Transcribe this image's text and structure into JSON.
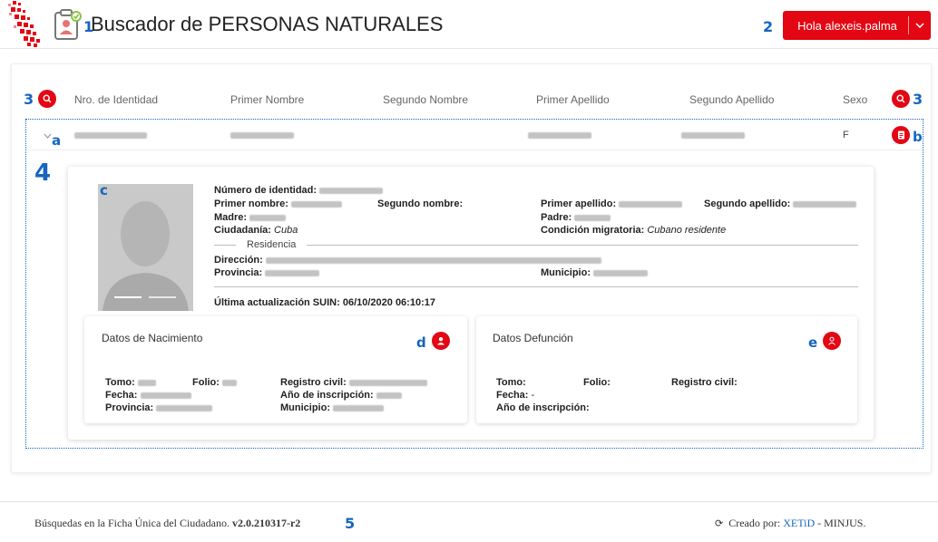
{
  "header": {
    "title": "Buscador de PERSONAS NATURALES",
    "user_button_label": "Hola alexeis.palma",
    "brand_color": "#e30613",
    "callout_color": "#1565c0"
  },
  "callouts": {
    "n1": "1",
    "n2": "2",
    "n3": "3",
    "n4": "4",
    "n5": "5",
    "a": "a",
    "b": "b",
    "c": "c",
    "d": "d",
    "e": "e"
  },
  "table": {
    "columns": [
      "Nro. de Identidad",
      "Primer Nombre",
      "Segundo Nombre",
      "Primer Apellido",
      "Segundo Apellido",
      "Sexo"
    ],
    "rows": [
      {
        "sexo": "F"
      }
    ]
  },
  "detail": {
    "numero_identidad_label": "Número de identidad:",
    "primer_nombre_label": "Primer nombre:",
    "segundo_nombre_label": "Segundo nombre:",
    "primer_apellido_label": "Primer apellido:",
    "segundo_apellido_label": "Segundo apellido:",
    "madre_label": "Madre:",
    "padre_label": "Padre:",
    "ciudadania_label": "Ciudadanía:",
    "ciudadania_value": "Cuba",
    "condicion_label": "Condición migratoria:",
    "condicion_value": "Cubano residente",
    "residencia_label": "Residencia",
    "direccion_label": "Dirección:",
    "provincia_label": "Provincia:",
    "municipio_label": "Municipio:",
    "ultima_label": "Última actualización SUIN:",
    "ultima_value": "06/10/2020 06:10:17"
  },
  "nacimiento": {
    "title": "Datos de Nacimiento",
    "tomo_label": "Tomo:",
    "folio_label": "Folio:",
    "registro_label": "Registro civil:",
    "fecha_label": "Fecha:",
    "anio_label": "Año de inscripción:",
    "provincia_label": "Provincia:",
    "municipio_label": "Municipio:"
  },
  "defuncion": {
    "title": "Datos Defunción",
    "tomo_label": "Tomo:",
    "folio_label": "Folio:",
    "registro_label": "Registro civil:",
    "fecha_label": "Fecha:",
    "fecha_value": "-",
    "anio_label": "Año de inscripción:"
  },
  "footer": {
    "text": "Búsquedas en la Ficha Única del Ciudadano.",
    "version": "v2.0.210317-r2",
    "created_label": "Creado por:",
    "xetid": "XETiD",
    "dash": "-",
    "minjus": "MINJUS."
  }
}
